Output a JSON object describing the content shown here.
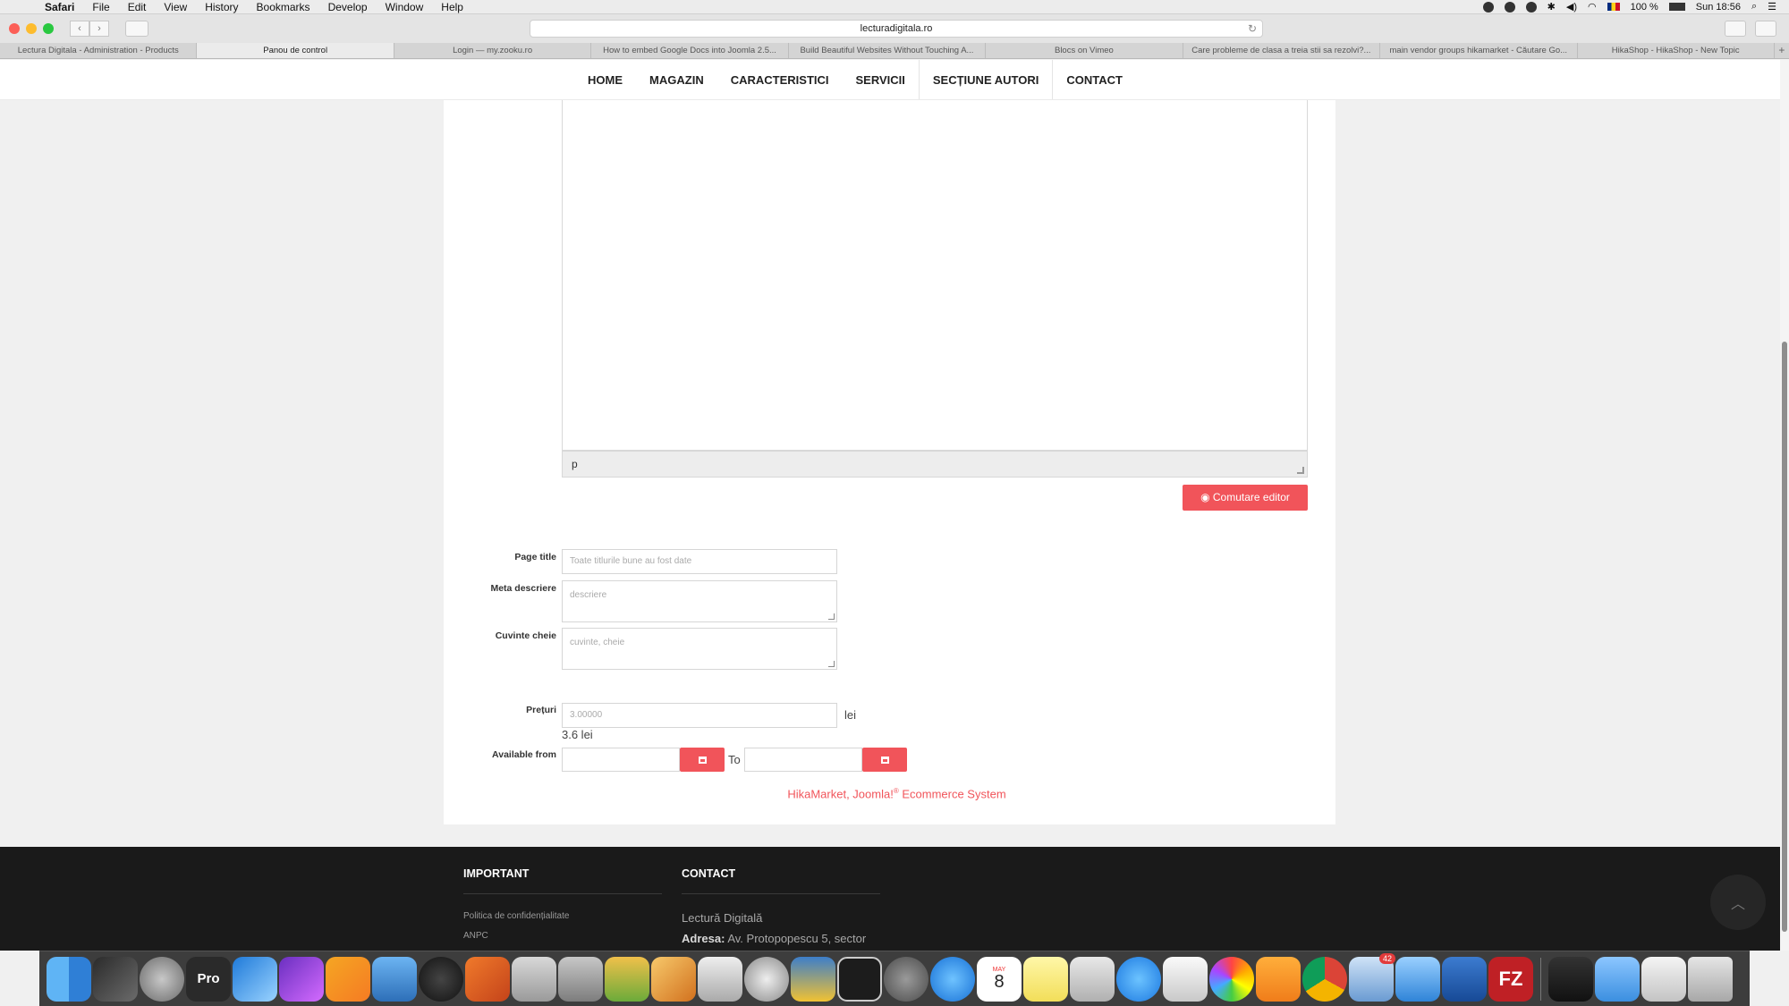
{
  "menubar": {
    "app": "Safari",
    "items": [
      "File",
      "Edit",
      "View",
      "History",
      "Bookmarks",
      "Develop",
      "Window",
      "Help"
    ],
    "battery": "100 %",
    "clock": "Sun 18:56"
  },
  "browser": {
    "url": "lecturadigitala.ro",
    "tabs": [
      "Lectura Digitala - Administration - Products",
      "Panou de control",
      "Login — my.zooku.ro",
      "How to embed Google Docs into Joomla 2.5...",
      "Build Beautiful Websites Without Touching A...",
      "Blocs on Vimeo",
      "Care probleme de clasa a treia stii sa rezolvi?...",
      "main vendor groups hikamarket - Căutare Go...",
      "HikaShop - HikaShop - New Topic"
    ],
    "active_tab": 1
  },
  "nav": {
    "home": "HOME",
    "magazin": "MAGAZIN",
    "caracteristici": "CARACTERISTICI",
    "servicii": "SERVICII",
    "autori": "SECȚIUNE AUTORI",
    "contact": "CONTACT"
  },
  "editor": {
    "status_path": "p",
    "toggle_label": "Comutare editor"
  },
  "form": {
    "page_title_label": "Page title",
    "page_title_placeholder": "Toate titlurile bune au fost date",
    "meta_label": "Meta descriere",
    "meta_placeholder": "descriere",
    "keywords_label": "Cuvinte cheie",
    "keywords_placeholder": "cuvinte, cheie",
    "price_label": "Prețuri",
    "price_value": "3.00000",
    "price_unit": "lei",
    "price_with_tax": "3.6 lei",
    "available_label": "Available from",
    "to_label": "To"
  },
  "credit": {
    "text": "HikaMarket, Joomla!",
    "sup": "®",
    "tail": " Ecommerce System"
  },
  "footer": {
    "important_heading": "IMPORTANT",
    "links": [
      "Politica de confidențialitate",
      "ANPC"
    ],
    "contact_heading": "CONTACT",
    "company": "Lectură Digitală",
    "address_label": "Adresa:",
    "address_value": "Av. Protopopescu 5, sector"
  },
  "dock": {
    "mail_badge": "42",
    "calendar_month": "MAY",
    "calendar_day": "8"
  },
  "colors": {
    "accent": "#f1545a",
    "footer_bg": "#1a1a1a"
  }
}
